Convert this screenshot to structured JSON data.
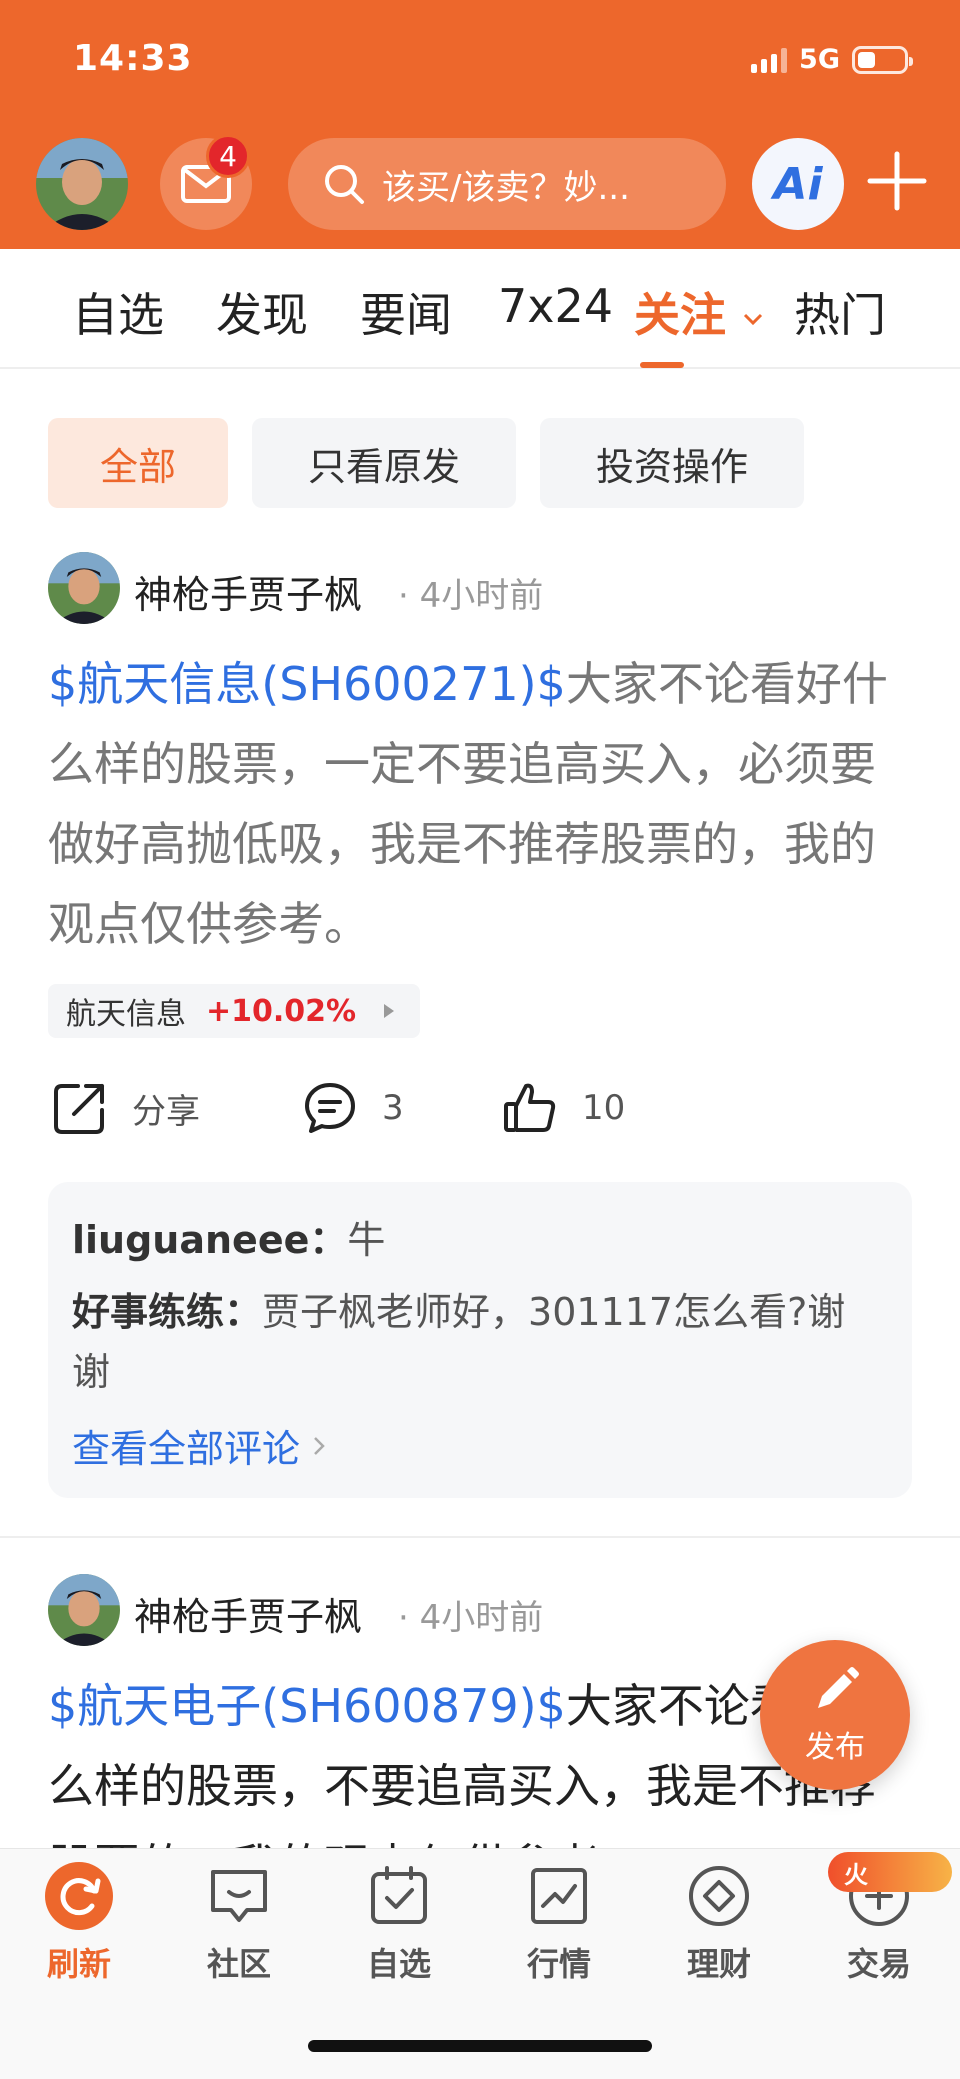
{
  "status_bar": {
    "time": "14:33",
    "network": "5G"
  },
  "header": {
    "mail_badge": "4",
    "search_placeholder": "该买/该卖？妙...",
    "ai_label": "Ai"
  },
  "tabs": [
    {
      "label": "自选"
    },
    {
      "label": "发现"
    },
    {
      "label": "要闻"
    },
    {
      "label": "7x24"
    },
    {
      "label": "关注",
      "active": true
    },
    {
      "label": "热门"
    }
  ],
  "filters": [
    {
      "label": "全部",
      "active": true
    },
    {
      "label": "只看原发"
    },
    {
      "label": "投资操作"
    }
  ],
  "posts": [
    {
      "author": "神枪手贾子枫",
      "time": "4小时前",
      "stock_tag": "$航天信息(SH600271)$",
      "text": "大家不论看好什么样的股票，一定不要追高买入，必须要做好高抛低吸，我是不推荐股票的，我的观点仅供参考。",
      "chip_name": "航天信息",
      "chip_change": "+10.02%",
      "share_label": "分享",
      "comment_count": "3",
      "like_count": "10",
      "comments": [
        {
          "user": "liuguaneee：",
          "text": "牛"
        },
        {
          "user": "好事练练：",
          "text": "贾子枫老师好，301117怎么看?谢谢"
        }
      ],
      "view_all": "查看全部评论"
    },
    {
      "author": "神枪手贾子枫",
      "time": "4小时前",
      "stock_tag": "$航天电子(SH600879)$",
      "text": "大家不论看好什么样的股票，不要追高买入，我是不推荐股票的，我的观点仅供参考。"
    }
  ],
  "fab": {
    "label": "发布"
  },
  "bottom_nav": [
    {
      "label": "刷新",
      "icon": "refresh-icon",
      "active": true
    },
    {
      "label": "社区",
      "icon": "chat-icon"
    },
    {
      "label": "自选",
      "icon": "check-box-icon"
    },
    {
      "label": "行情",
      "icon": "chart-icon"
    },
    {
      "label": "理财",
      "icon": "diamond-icon"
    },
    {
      "label": "交易",
      "icon": "plus-circle-icon"
    }
  ],
  "hot_pill": "火",
  "colors": {
    "brand": "#ed672c",
    "link": "#2f6fe0",
    "up": "#e3262b"
  }
}
